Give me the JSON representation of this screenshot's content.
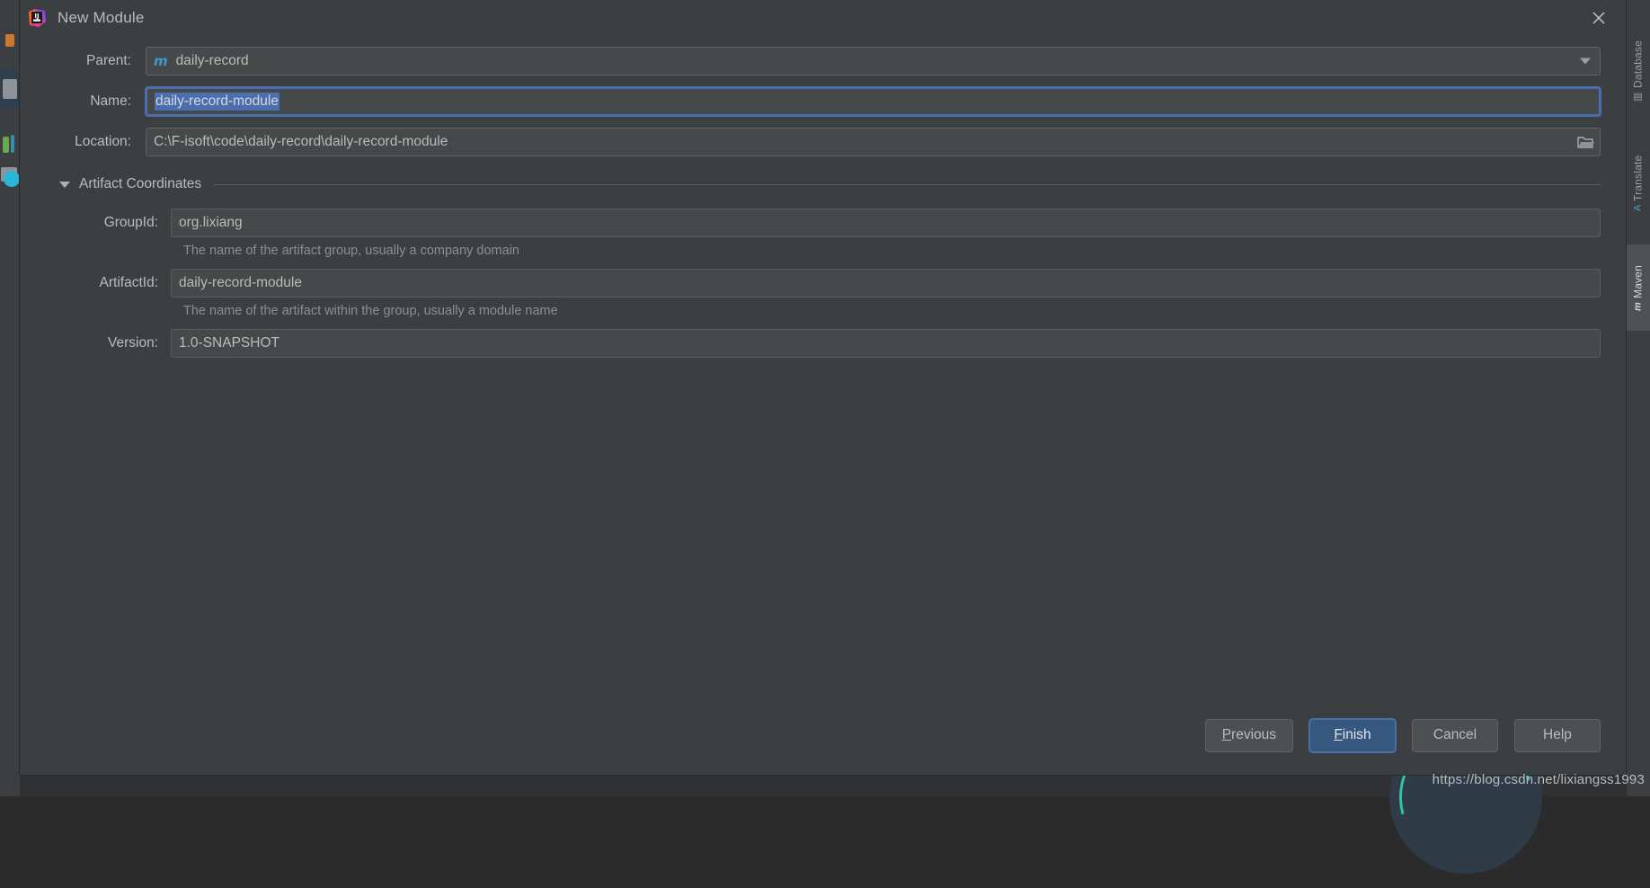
{
  "window": {
    "title": "New Module",
    "logo_icon": "intellij-idea-logo",
    "close_icon": "close-icon"
  },
  "form": {
    "parent": {
      "label": "Parent:",
      "value": "daily-record",
      "icon": "maven-module-icon",
      "dropdown_icon": "chevron-down-icon"
    },
    "name": {
      "label": "Name:",
      "value": "daily-record-module",
      "selected": true
    },
    "location": {
      "label": "Location:",
      "value": "C:\\F-isoft\\code\\daily-record\\daily-record-module",
      "browse_icon": "folder-icon"
    }
  },
  "artifact_section": {
    "title": "Artifact Coordinates",
    "expanded": true,
    "collapse_icon": "triangle-down-icon",
    "fields": [
      {
        "label": "GroupId:",
        "value": "org.lixiang",
        "hint": "The name of the artifact group, usually a company domain"
      },
      {
        "label": "ArtifactId:",
        "value": "daily-record-module",
        "hint": "The name of the artifact within the group, usually a module name"
      },
      {
        "label": "Version:",
        "value": "1.0-SNAPSHOT",
        "hint": ""
      }
    ]
  },
  "footer": {
    "buttons": [
      {
        "label": "Previous",
        "mnemonic": "P",
        "primary": false
      },
      {
        "label": "Finish",
        "mnemonic": "F",
        "primary": true
      },
      {
        "label": "Cancel",
        "mnemonic": "",
        "primary": false
      },
      {
        "label": "Help",
        "mnemonic": "",
        "primary": false
      }
    ]
  },
  "watermark": "https://blog.csdn.net/lixiangss1993",
  "ide": {
    "right_tabs": [
      {
        "label": "Database",
        "icon": "database-icon",
        "active": false
      },
      {
        "label": "Translate",
        "icon": "translate-icon",
        "active": false
      },
      {
        "label": "Maven",
        "icon": "maven-icon",
        "active": true
      }
    ]
  },
  "colors": {
    "accent": "#4b6eaf",
    "primary_button": "#365880",
    "dialog_bg": "#3c3f41",
    "field_bg": "#45494a",
    "text": "#bbbbbb",
    "hint_text": "#8c8f91",
    "maven_icon": "#3e9bc9"
  }
}
